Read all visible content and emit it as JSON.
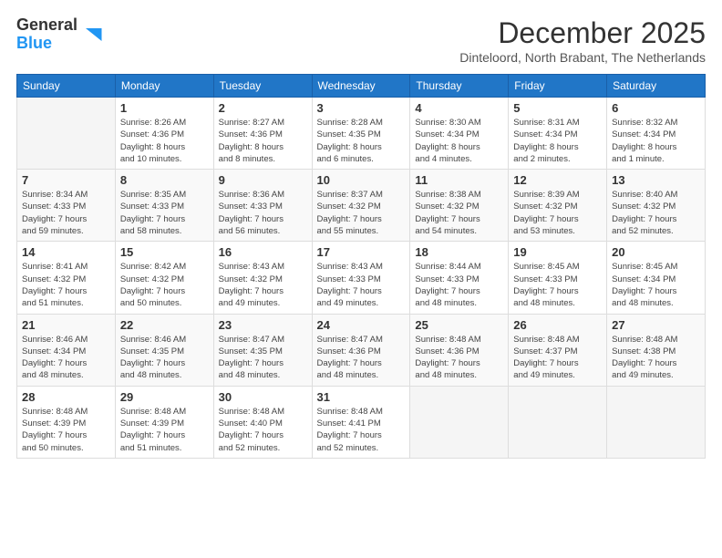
{
  "logo": {
    "general": "General",
    "blue": "Blue"
  },
  "header": {
    "month_year": "December 2025",
    "location": "Dinteloord, North Brabant, The Netherlands"
  },
  "weekdays": [
    "Sunday",
    "Monday",
    "Tuesday",
    "Wednesday",
    "Thursday",
    "Friday",
    "Saturday"
  ],
  "weeks": [
    [
      {
        "day": "",
        "info": ""
      },
      {
        "day": "1",
        "info": "Sunrise: 8:26 AM\nSunset: 4:36 PM\nDaylight: 8 hours\nand 10 minutes."
      },
      {
        "day": "2",
        "info": "Sunrise: 8:27 AM\nSunset: 4:36 PM\nDaylight: 8 hours\nand 8 minutes."
      },
      {
        "day": "3",
        "info": "Sunrise: 8:28 AM\nSunset: 4:35 PM\nDaylight: 8 hours\nand 6 minutes."
      },
      {
        "day": "4",
        "info": "Sunrise: 8:30 AM\nSunset: 4:34 PM\nDaylight: 8 hours\nand 4 minutes."
      },
      {
        "day": "5",
        "info": "Sunrise: 8:31 AM\nSunset: 4:34 PM\nDaylight: 8 hours\nand 2 minutes."
      },
      {
        "day": "6",
        "info": "Sunrise: 8:32 AM\nSunset: 4:34 PM\nDaylight: 8 hours\nand 1 minute."
      }
    ],
    [
      {
        "day": "7",
        "info": "Sunrise: 8:34 AM\nSunset: 4:33 PM\nDaylight: 7 hours\nand 59 minutes."
      },
      {
        "day": "8",
        "info": "Sunrise: 8:35 AM\nSunset: 4:33 PM\nDaylight: 7 hours\nand 58 minutes."
      },
      {
        "day": "9",
        "info": "Sunrise: 8:36 AM\nSunset: 4:33 PM\nDaylight: 7 hours\nand 56 minutes."
      },
      {
        "day": "10",
        "info": "Sunrise: 8:37 AM\nSunset: 4:32 PM\nDaylight: 7 hours\nand 55 minutes."
      },
      {
        "day": "11",
        "info": "Sunrise: 8:38 AM\nSunset: 4:32 PM\nDaylight: 7 hours\nand 54 minutes."
      },
      {
        "day": "12",
        "info": "Sunrise: 8:39 AM\nSunset: 4:32 PM\nDaylight: 7 hours\nand 53 minutes."
      },
      {
        "day": "13",
        "info": "Sunrise: 8:40 AM\nSunset: 4:32 PM\nDaylight: 7 hours\nand 52 minutes."
      }
    ],
    [
      {
        "day": "14",
        "info": "Sunrise: 8:41 AM\nSunset: 4:32 PM\nDaylight: 7 hours\nand 51 minutes."
      },
      {
        "day": "15",
        "info": "Sunrise: 8:42 AM\nSunset: 4:32 PM\nDaylight: 7 hours\nand 50 minutes."
      },
      {
        "day": "16",
        "info": "Sunrise: 8:43 AM\nSunset: 4:32 PM\nDaylight: 7 hours\nand 49 minutes."
      },
      {
        "day": "17",
        "info": "Sunrise: 8:43 AM\nSunset: 4:33 PM\nDaylight: 7 hours\nand 49 minutes."
      },
      {
        "day": "18",
        "info": "Sunrise: 8:44 AM\nSunset: 4:33 PM\nDaylight: 7 hours\nand 48 minutes."
      },
      {
        "day": "19",
        "info": "Sunrise: 8:45 AM\nSunset: 4:33 PM\nDaylight: 7 hours\nand 48 minutes."
      },
      {
        "day": "20",
        "info": "Sunrise: 8:45 AM\nSunset: 4:34 PM\nDaylight: 7 hours\nand 48 minutes."
      }
    ],
    [
      {
        "day": "21",
        "info": "Sunrise: 8:46 AM\nSunset: 4:34 PM\nDaylight: 7 hours\nand 48 minutes."
      },
      {
        "day": "22",
        "info": "Sunrise: 8:46 AM\nSunset: 4:35 PM\nDaylight: 7 hours\nand 48 minutes."
      },
      {
        "day": "23",
        "info": "Sunrise: 8:47 AM\nSunset: 4:35 PM\nDaylight: 7 hours\nand 48 minutes."
      },
      {
        "day": "24",
        "info": "Sunrise: 8:47 AM\nSunset: 4:36 PM\nDaylight: 7 hours\nand 48 minutes."
      },
      {
        "day": "25",
        "info": "Sunrise: 8:48 AM\nSunset: 4:36 PM\nDaylight: 7 hours\nand 48 minutes."
      },
      {
        "day": "26",
        "info": "Sunrise: 8:48 AM\nSunset: 4:37 PM\nDaylight: 7 hours\nand 49 minutes."
      },
      {
        "day": "27",
        "info": "Sunrise: 8:48 AM\nSunset: 4:38 PM\nDaylight: 7 hours\nand 49 minutes."
      }
    ],
    [
      {
        "day": "28",
        "info": "Sunrise: 8:48 AM\nSunset: 4:39 PM\nDaylight: 7 hours\nand 50 minutes."
      },
      {
        "day": "29",
        "info": "Sunrise: 8:48 AM\nSunset: 4:39 PM\nDaylight: 7 hours\nand 51 minutes."
      },
      {
        "day": "30",
        "info": "Sunrise: 8:48 AM\nSunset: 4:40 PM\nDaylight: 7 hours\nand 52 minutes."
      },
      {
        "day": "31",
        "info": "Sunrise: 8:48 AM\nSunset: 4:41 PM\nDaylight: 7 hours\nand 52 minutes."
      },
      {
        "day": "",
        "info": ""
      },
      {
        "day": "",
        "info": ""
      },
      {
        "day": "",
        "info": ""
      }
    ]
  ]
}
